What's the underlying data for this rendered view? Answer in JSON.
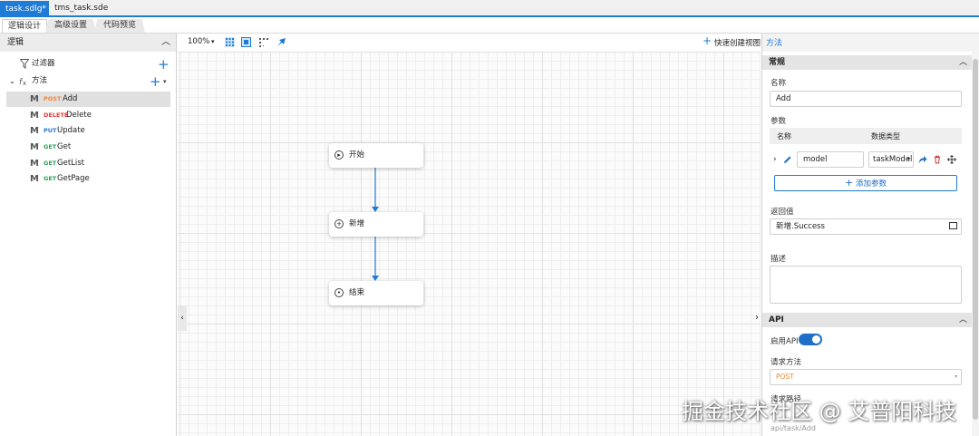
{
  "file_tabs": [
    {
      "label": "task.sdlg*",
      "close": "✕"
    },
    {
      "label": "tms_task.sde"
    }
  ],
  "sub_tabs": [
    "逻辑设计",
    "高级设置",
    "代码预览"
  ],
  "left_panel": {
    "title": "逻辑",
    "filter_label": "过滤器",
    "methods_label": "方法",
    "methods": [
      {
        "verb": "POST",
        "name": "Add",
        "verb_color": "#f0883a"
      },
      {
        "verb": "DELETE",
        "name": "Delete",
        "verb_color": "#e53935"
      },
      {
        "verb": "PUT",
        "name": "Update",
        "verb_color": "#1e7bd6"
      },
      {
        "verb": "GET",
        "name": "Get",
        "verb_color": "#2e9d5c"
      },
      {
        "verb": "GET",
        "name": "GetList",
        "verb_color": "#2e9d5c"
      },
      {
        "verb": "GET",
        "name": "GetPage",
        "verb_color": "#2e9d5c"
      }
    ]
  },
  "canvas": {
    "zoom": "100%",
    "quick_create": "快速创建视图",
    "nodes": [
      "开始",
      "新增",
      "结束"
    ]
  },
  "right_panel": {
    "tab": "方法",
    "general_section": "常规",
    "name_label": "名称",
    "name_value": "Add",
    "params_label": "参数",
    "param_col_name": "名称",
    "param_col_type": "数据类型",
    "param_name_value": "model",
    "param_type_value": "taskModel",
    "add_param_button": "添加参数",
    "return_label": "返回值",
    "return_value": "新增.Success",
    "desc_label": "描述",
    "api_section": "API",
    "enable_api_label": "启用API",
    "enable_api": true,
    "method_label": "请求方法",
    "method_value": "POST",
    "path_label": "请求路径",
    "path_value": "api/task/Add"
  },
  "watermark": "掘金技术社区 @ 艾普阳科技",
  "colors": {
    "accent": "#1e7bd6",
    "post": "#f0883a",
    "delete": "#e53935",
    "get": "#2e9d5c"
  }
}
